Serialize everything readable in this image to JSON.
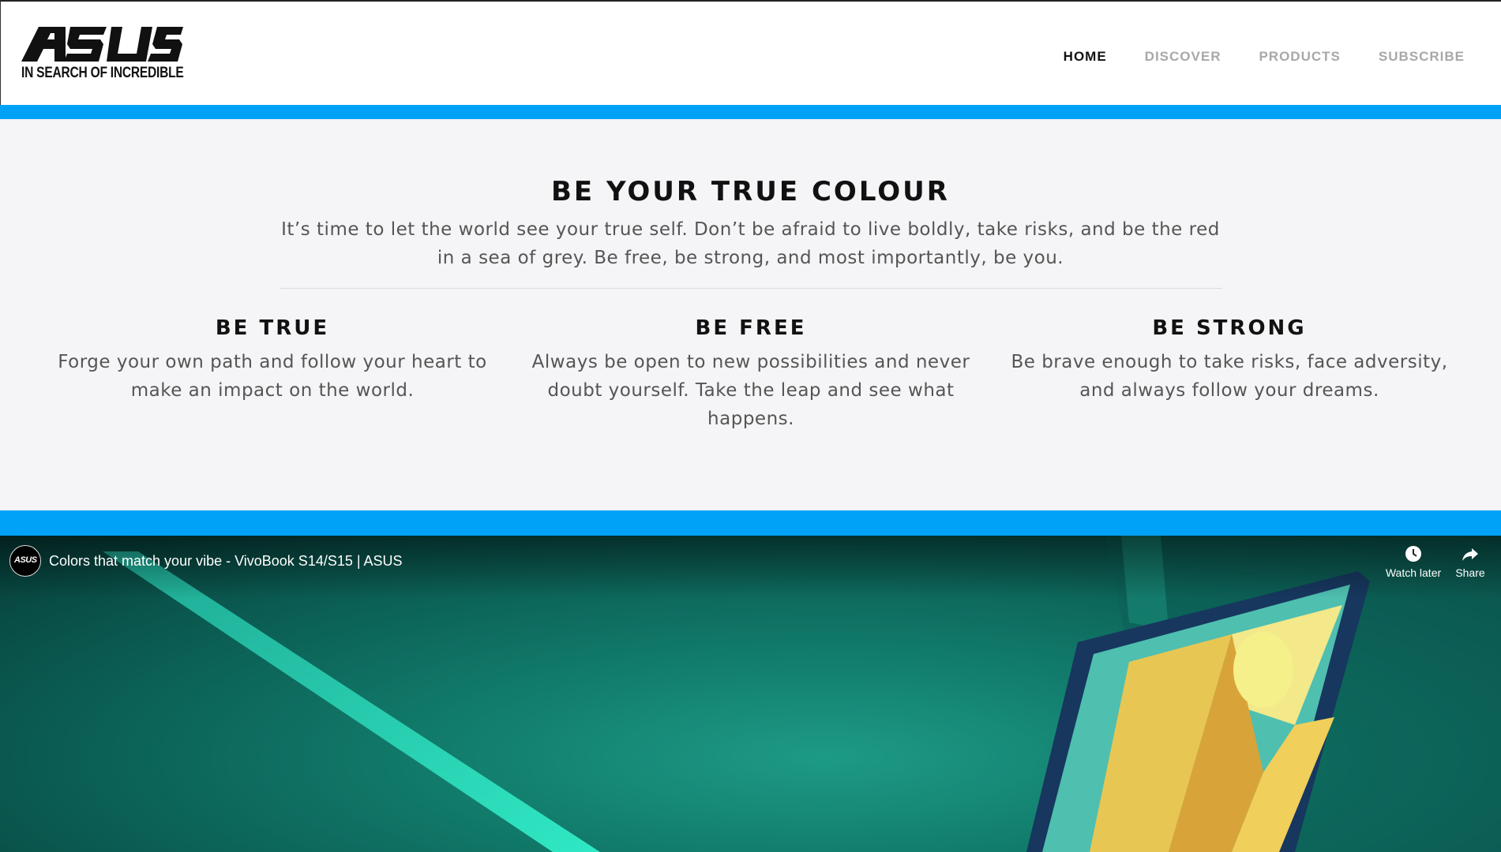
{
  "header": {
    "logo_text": "ASUS",
    "tagline": "IN SEARCH OF INCREDIBLE",
    "nav": [
      {
        "label": "HOME",
        "active": true
      },
      {
        "label": "DISCOVER",
        "active": false
      },
      {
        "label": "PRODUCTS",
        "active": false
      },
      {
        "label": "SUBSCRIBE",
        "active": false
      }
    ]
  },
  "hero": {
    "title": "BE YOUR TRUE COLOUR",
    "intro": "It’s time to let the world see your true self. Don’t be afraid to live boldly, take risks, and be the red in a sea of grey. Be free, be strong, and most importantly, be you.",
    "columns": [
      {
        "title": "BE TRUE",
        "text": "Forge your own path and follow your heart to make an impact on the world."
      },
      {
        "title": "BE FREE",
        "text": "Always be open to new possibilities and never doubt yourself. Take the leap and see what happens."
      },
      {
        "title": "BE STRONG",
        "text": "Be brave enough to take risks, face adversity, and always follow your dreams."
      }
    ]
  },
  "video": {
    "title": "Colors that match your vibe - VivoBook S14/S15 | ASUS",
    "channel_avatar_text": "ASUS",
    "watch_later_label": "Watch later",
    "share_label": "Share",
    "icons": {
      "watch_later": "clock-icon",
      "share": "share-arrow-icon"
    }
  },
  "colors": {
    "accent_bar": "#00a2f7",
    "hero_bg": "#f5f5f7",
    "nav_active": "#111111",
    "nav_inactive": "#a8a8a8"
  }
}
